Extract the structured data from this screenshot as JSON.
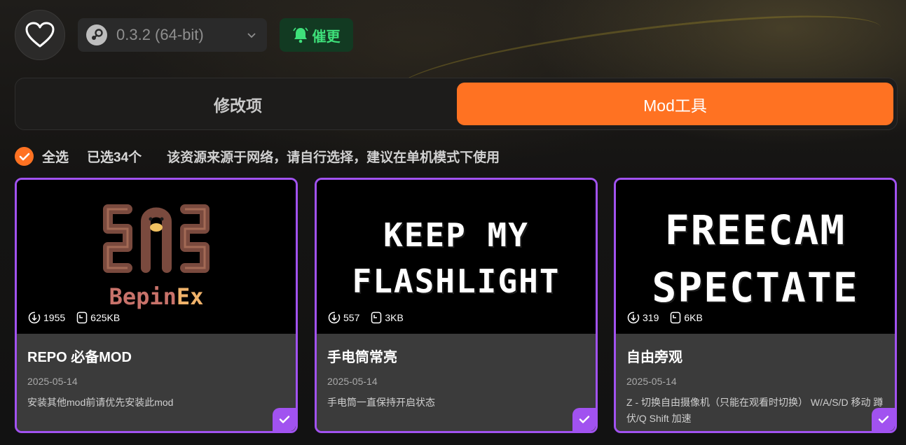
{
  "header": {
    "version_label": "0.3.2 (64-bit)",
    "remind_label": "催更"
  },
  "tabs": [
    {
      "label": "修改项",
      "active": false
    },
    {
      "label": "Mod工具",
      "active": true
    }
  ],
  "filter": {
    "select_all_label": "全选",
    "selected_count": "已选34个",
    "notice": "该资源来源于网络，请自行选择，建议在单机模式下使用"
  },
  "colors": {
    "accent_orange": "#ff7222",
    "accent_purple": "#a152f0",
    "remind_green": "#3ee07a"
  },
  "mods": [
    {
      "thumb_text": [
        "Bepin",
        "Ex"
      ],
      "downloads": "1955",
      "size": "625KB",
      "title": "REPO 必备MOD",
      "date": "2025-05-14",
      "description": "安装其他mod前请优先安装此mod",
      "selected": true
    },
    {
      "thumb_text": [
        "KEEP MY",
        "FLASHLIGHT"
      ],
      "downloads": "557",
      "size": "3KB",
      "title": "手电筒常亮",
      "date": "2025-05-14",
      "description": "手电筒一直保持开启状态",
      "selected": true
    },
    {
      "thumb_text": [
        "FREECAM",
        "SPECTATE"
      ],
      "downloads": "319",
      "size": "6KB",
      "title": "自由旁观",
      "date": "2025-05-14",
      "description": "Z - 切换自由摄像机（只能在观看时切换） W/A/S/D 移动 蹲伏/Q Shift 加速",
      "selected": true
    }
  ]
}
